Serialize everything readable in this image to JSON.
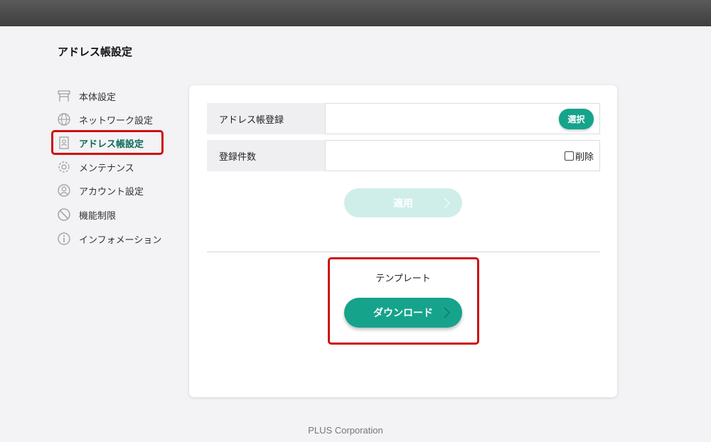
{
  "page": {
    "title": "アドレス帳設定"
  },
  "sidebar": {
    "items": [
      {
        "label": "本体設定",
        "icon": "device-icon"
      },
      {
        "label": "ネットワーク設定",
        "icon": "globe-icon"
      },
      {
        "label": "アドレス帳設定",
        "icon": "address-book-icon",
        "active": true
      },
      {
        "label": "メンテナンス",
        "icon": "gear-icon"
      },
      {
        "label": "アカウント設定",
        "icon": "user-icon"
      },
      {
        "label": "機能制限",
        "icon": "prohibited-icon"
      },
      {
        "label": "インフォメーション",
        "icon": "info-icon"
      }
    ]
  },
  "form": {
    "address_book_register_label": "アドレス帳登録",
    "select_button": "選択",
    "registered_count_label": "登録件数",
    "delete_label": "削除",
    "apply_button": "適用"
  },
  "template": {
    "label": "テンプレート",
    "download_button": "ダウンロード"
  },
  "footer": {
    "text": "PLUS Corporation"
  },
  "colors": {
    "accent": "#16a38c",
    "accent_disabled": "#cfeeea",
    "highlight": "#cc1111",
    "active_text": "#0d6b5a"
  }
}
